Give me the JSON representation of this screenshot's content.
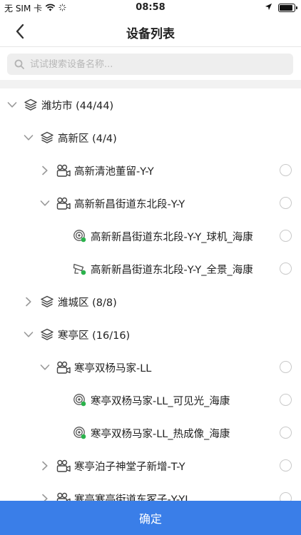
{
  "status_bar": {
    "carrier": "无 SIM 卡",
    "time": "08:58"
  },
  "header": {
    "title": "设备列表"
  },
  "search": {
    "placeholder": "试试搜索设备名称..."
  },
  "tree": {
    "rows": [
      {
        "label": "潍坊市 (44/44)",
        "level": 0,
        "expander": "expanded",
        "icon": "layers-icon",
        "radio": false
      },
      {
        "label": "高新区 (4/4)",
        "level": 1,
        "expander": "expanded",
        "icon": "layers-icon",
        "radio": false
      },
      {
        "label": "高新清池董留-Y-Y",
        "level": 2,
        "expander": "collapsed",
        "icon": "camera-group-icon",
        "radio": true
      },
      {
        "label": "高新新昌街道东北段-Y-Y",
        "level": 2,
        "expander": "expanded",
        "icon": "camera-group-icon",
        "radio": true
      },
      {
        "label": "高新新昌街道东北段-Y-Y_球机_海康",
        "level": 3,
        "expander": "none",
        "icon": "dome-camera-online-icon",
        "radio": true
      },
      {
        "label": "高新新昌街道东北段-Y-Y_全景_海康",
        "level": 3,
        "expander": "none",
        "icon": "bullet-camera-online-icon",
        "radio": true
      },
      {
        "label": "潍城区 (8/8)",
        "level": 1,
        "expander": "collapsed",
        "icon": "layers-icon",
        "radio": false
      },
      {
        "label": "寒亭区 (16/16)",
        "level": 1,
        "expander": "expanded",
        "icon": "layers-icon",
        "radio": false
      },
      {
        "label": "寒亭双杨马家-LL",
        "level": 2,
        "expander": "expanded",
        "icon": "camera-group-icon",
        "radio": true
      },
      {
        "label": "寒亭双杨马家-LL_可见光_海康",
        "level": 3,
        "expander": "none",
        "icon": "dome-camera-online-icon",
        "radio": true
      },
      {
        "label": "寒亭双杨马家-LL_热成像_海康",
        "level": 3,
        "expander": "none",
        "icon": "dome-camera-online-icon",
        "radio": true
      },
      {
        "label": "寒亭泊子神堂子新增-T-Y",
        "level": 2,
        "expander": "collapsed",
        "icon": "camera-group-icon",
        "radio": true
      },
      {
        "label": "寒亭寒亭街道东冢子-Y-YL",
        "level": 2,
        "expander": "collapsed",
        "icon": "camera-group-icon",
        "radio": true
      }
    ]
  },
  "footer": {
    "confirm_label": "确定"
  },
  "colors": {
    "accent": "#3a7ee8",
    "online": "#2bb24c"
  }
}
